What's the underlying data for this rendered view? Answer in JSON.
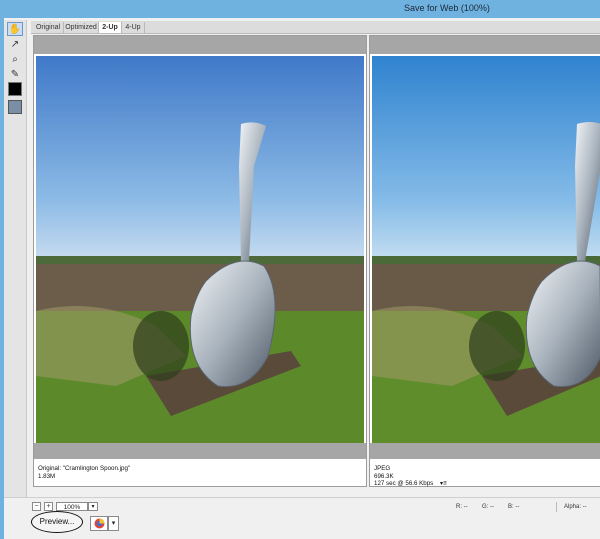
{
  "window": {
    "title": "Save for Web (100%)"
  },
  "tabs": [
    {
      "label": "Original",
      "active": false
    },
    {
      "label": "Optimized",
      "active": false
    },
    {
      "label": "2-Up",
      "active": true
    },
    {
      "label": "4-Up",
      "active": false
    }
  ],
  "tools": [
    {
      "icon": "hand-icon",
      "glyph": "✋",
      "selected": true
    },
    {
      "icon": "slice-select-icon",
      "glyph": "↗"
    },
    {
      "icon": "zoom-icon",
      "glyph": "⌕"
    },
    {
      "icon": "eyedropper-icon",
      "glyph": "✎"
    }
  ],
  "swatches": {
    "eyedropper_color": "#000000"
  },
  "panes": {
    "original": {
      "line1": "Original: \"Cramlington Spoon.jpg\"",
      "line2": "1.83M"
    },
    "optimized": {
      "line1": "JPEG",
      "line2": "696.3K",
      "line3": "127 sec @ 56.6 Kbps",
      "line3_icon": "▾≡"
    }
  },
  "bottom": {
    "zoom_minus": "−",
    "zoom_plus": "+",
    "zoom_value": "100%",
    "r_label": "R: --",
    "g_label": "G: --",
    "b_label": "B: --",
    "alpha_label": "Alpha: --",
    "preview_label": "Preview...",
    "browser_drop": "▾"
  },
  "colors": {
    "titlebar": "#6fb1df",
    "sky_original_top": "#3f79c8",
    "sky_optimized_top": "#2f83cf",
    "grass": "#5c8a2a",
    "field": "#6b5d49"
  }
}
